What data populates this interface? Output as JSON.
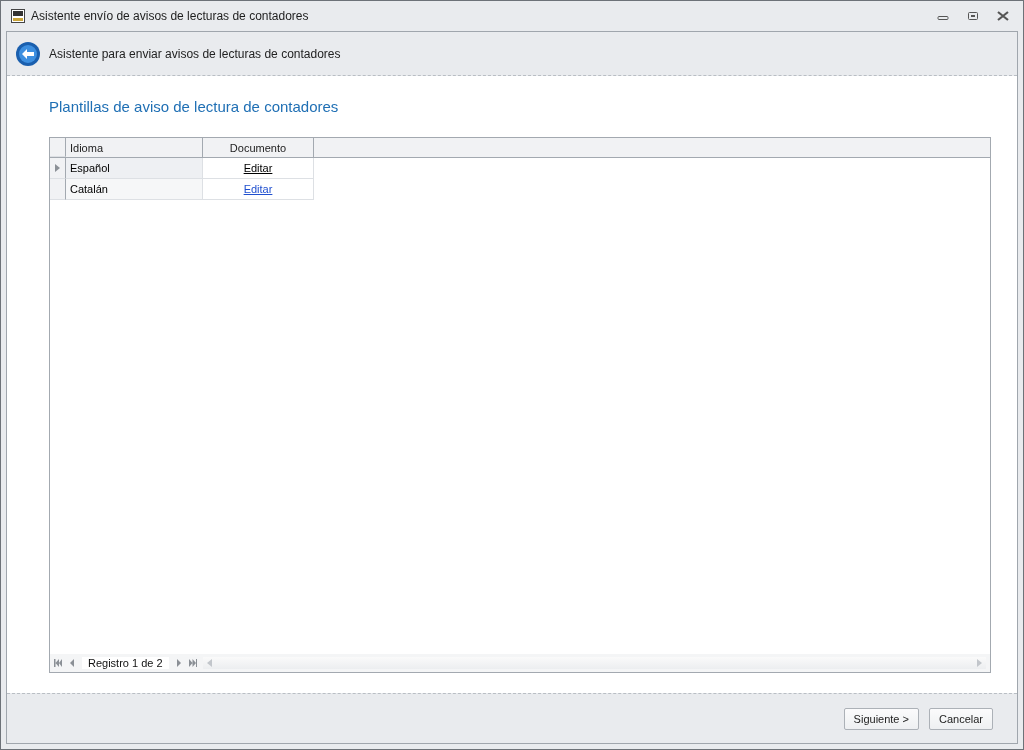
{
  "window": {
    "title": "Asistente envío de avisos de lecturas de contadores"
  },
  "header": {
    "title": "Asistente para enviar avisos de lecturas de contadores"
  },
  "section_title": "Plantillas de aviso de lectura de contadores",
  "table": {
    "columns": [
      "Idioma",
      "Documento"
    ],
    "rows": [
      {
        "idioma": "Español",
        "documento": "Editar",
        "selected": true
      },
      {
        "idioma": "Catalán",
        "documento": "Editar",
        "selected": false
      }
    ]
  },
  "navigator": {
    "text": "Registro 1 de 2"
  },
  "buttons": [
    "Siguiente >",
    "Cancelar"
  ]
}
